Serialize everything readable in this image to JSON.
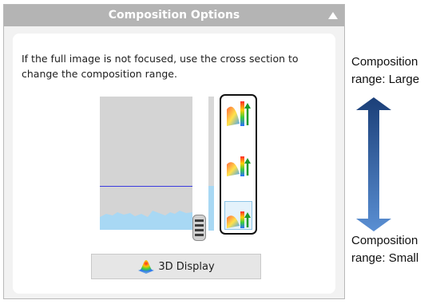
{
  "panel": {
    "title": "Composition Options",
    "instructions": "If the full image is not focused, use the cross section to change the composition range.",
    "display_button_label": "3D Display"
  },
  "range_buttons": [
    {
      "name": "large",
      "selected": false
    },
    {
      "name": "medium",
      "selected": false
    },
    {
      "name": "small",
      "selected": true
    }
  ],
  "captions": {
    "large": "Composition range: Large",
    "small": "Composition range: Small"
  },
  "colors": {
    "header": "#b4b4b4",
    "arrow_top": "#1b3f78",
    "arrow_bottom": "#5a8fd3",
    "profile": "#a8d8f4",
    "range_line": "#3a3adf"
  }
}
